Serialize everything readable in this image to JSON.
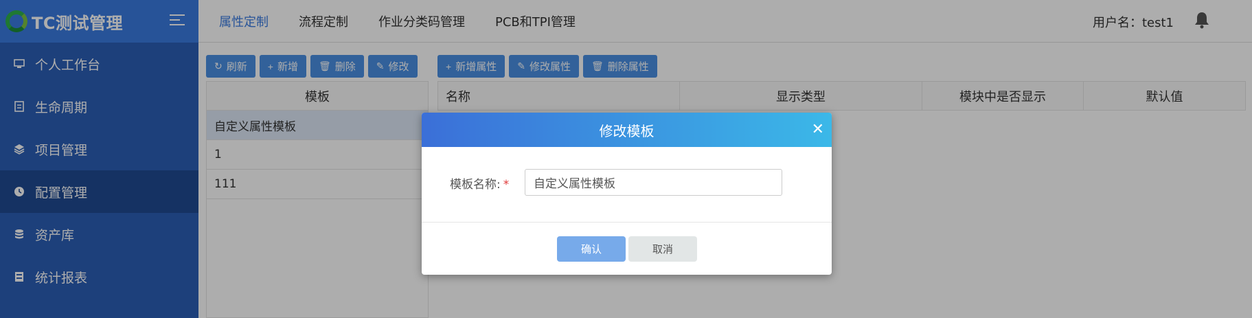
{
  "app": {
    "title": "TC测试管理"
  },
  "sidebar": {
    "items": [
      {
        "label": "个人工作台",
        "icon": "monitor-icon"
      },
      {
        "label": "生命周期",
        "icon": "document-icon"
      },
      {
        "label": "项目管理",
        "icon": "layers-icon"
      },
      {
        "label": "配置管理",
        "icon": "clock-icon",
        "active": true
      },
      {
        "label": "资产库",
        "icon": "database-icon"
      },
      {
        "label": "统计报表",
        "icon": "report-icon"
      }
    ]
  },
  "topnav": {
    "tabs": [
      "属性定制",
      "流程定制",
      "作业分类码管理",
      "PCB和TPI管理"
    ],
    "active_tab": "属性定制",
    "user_label": "用户名：test1"
  },
  "toolbar": {
    "refresh": "刷新",
    "add": "新增",
    "delete": "删除",
    "edit": "修改",
    "add_attr": "新增属性",
    "edit_attr": "修改属性",
    "delete_attr": "删除属性"
  },
  "template_table": {
    "header": "模板",
    "rows": [
      "自定义属性模板",
      "1",
      "111"
    ]
  },
  "attr_table": {
    "columns": [
      "名称",
      "显示类型",
      "模块中是否显示",
      "默认值"
    ]
  },
  "modal": {
    "title": "修改模板",
    "field_label": "模板名称:",
    "required_mark": "*",
    "field_value": "自定义属性模板",
    "confirm": "确认",
    "cancel": "取消"
  },
  "colors": {
    "sidebar": "#2b5fb6",
    "accent": "#3a7be0",
    "modal_header_start": "#3b6fd8",
    "modal_header_end": "#3bb8e8"
  }
}
